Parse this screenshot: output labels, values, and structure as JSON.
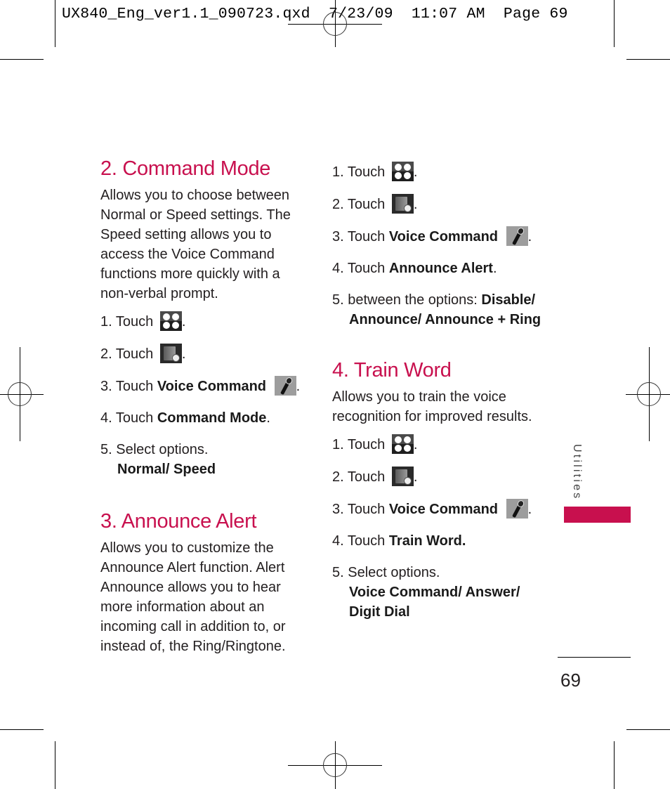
{
  "slug": "UX840_Eng_ver1.1_090723.qxd  7/23/09  11:07 AM  Page 69",
  "left_column": {
    "command_mode": {
      "title": "2. Command Mode",
      "body": "Allows you to choose between Normal or Speed settings. The Speed setting allows you to access the Voice Command functions more quickly with a non-verbal prompt.",
      "steps": [
        {
          "prefix": "1. Touch",
          "icon": "menu-grid-icon"
        },
        {
          "prefix": "2. Touch",
          "icon": "utilities-book-icon"
        },
        {
          "prefix": "3. Touch",
          "bold": "Voice Command",
          "icon": "microphone-icon"
        },
        {
          "prefix": "4. Touch",
          "bold": "Command Mode"
        },
        {
          "prefix": "5. Select options.",
          "bold": "Normal/ Speed"
        }
      ]
    },
    "announce_alert": {
      "title": "3. Announce Alert",
      "body": "Allows you to customize the Announce Alert function. Alert Announce allows you to hear more information about an incoming call in addition to, or instead of, the Ring/Ringtone."
    }
  },
  "right_column": {
    "announce_steps": [
      {
        "prefix": "1. Touch",
        "icon": "menu-grid-icon"
      },
      {
        "prefix": "2. Touch",
        "icon": "utilities-book-icon"
      },
      {
        "prefix": "3. Touch",
        "bold": "Voice Command",
        "icon": "microphone-icon"
      },
      {
        "prefix": "4. Touch",
        "bold": "Announce Alert"
      },
      {
        "prefix": "5. between the options:",
        "bold": "Disable/",
        "bold2": "Announce/ Announce + Ring"
      }
    ],
    "train_word": {
      "title": "4. Train Word",
      "body": "Allows you to train the voice recognition for improved results.",
      "steps": [
        {
          "prefix": "1. Touch",
          "icon": "menu-grid-icon"
        },
        {
          "prefix": "2. Touch",
          "icon": "utilities-book-icon"
        },
        {
          "prefix": "3. Touch",
          "bold": "Voice Command",
          "icon": "microphone-icon"
        },
        {
          "prefix": "4. Touch",
          "bold": "Train Word."
        },
        {
          "prefix": "5. Select options.",
          "bold": "Voice Command/ Answer/",
          "bold2": "Digit Dial"
        }
      ]
    }
  },
  "side_tab": {
    "label": "Utilities",
    "color": "#c8104e"
  },
  "page_number": "69",
  "accent_color": "#c8104e"
}
